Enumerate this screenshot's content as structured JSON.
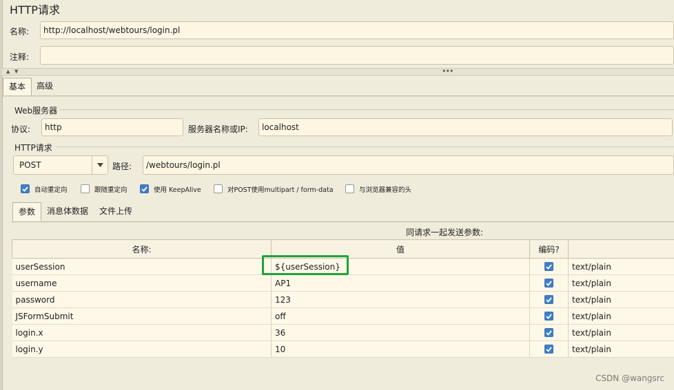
{
  "panel": {
    "title": "HTTP请求",
    "name_label": "名称:",
    "name_value": "http://localhost/webtours/login.pl",
    "comment_label": "注释:",
    "comment_value": ""
  },
  "tabs": [
    {
      "label": "基本",
      "active": true
    },
    {
      "label": "高级",
      "active": false
    }
  ],
  "web_server": {
    "legend": "Web服务器",
    "protocol_label": "协议:",
    "protocol_value": "http",
    "server_label": "服务器名称或IP:",
    "server_value": "localhost"
  },
  "http_request": {
    "legend": "HTTP请求",
    "method": "POST",
    "path_label": "路径:",
    "path_value": "/webtours/login.pl"
  },
  "options": [
    {
      "label": "自动重定向",
      "checked": true
    },
    {
      "label": "跟随重定向",
      "checked": false
    },
    {
      "label": "使用 KeepAlive",
      "checked": true
    },
    {
      "label": "对POST使用multipart / form-data",
      "checked": false
    },
    {
      "label": "与浏览器兼容的头",
      "checked": false
    }
  ],
  "subtabs": [
    {
      "label": "参数",
      "active": true
    },
    {
      "label": "消息体数据",
      "active": false
    },
    {
      "label": "文件上传",
      "active": false
    }
  ],
  "params": {
    "caption": "同请求一起发送参数:",
    "columns": [
      "名称:",
      "值",
      "编码?",
      ""
    ],
    "rows": [
      {
        "name": "userSession",
        "value": "${userSession}",
        "encode": true,
        "content_type": "text/plain"
      },
      {
        "name": "username",
        "value": "AP1",
        "encode": true,
        "content_type": "text/plain"
      },
      {
        "name": "password",
        "value": "123",
        "encode": true,
        "content_type": "text/plain"
      },
      {
        "name": "JSFormSubmit",
        "value": "off",
        "encode": true,
        "content_type": "text/plain"
      },
      {
        "name": "login.x",
        "value": "36",
        "encode": true,
        "content_type": "text/plain"
      },
      {
        "name": "login.y",
        "value": "10",
        "encode": true,
        "content_type": "text/plain"
      }
    ]
  },
  "watermark": "CSDN @wangsrc",
  "colors": {
    "panel_bg": "#f0ecdc",
    "field_bg": "#fdf6e2",
    "checkbox_on": "#3f7ec8",
    "highlight": "#1fa23a"
  }
}
